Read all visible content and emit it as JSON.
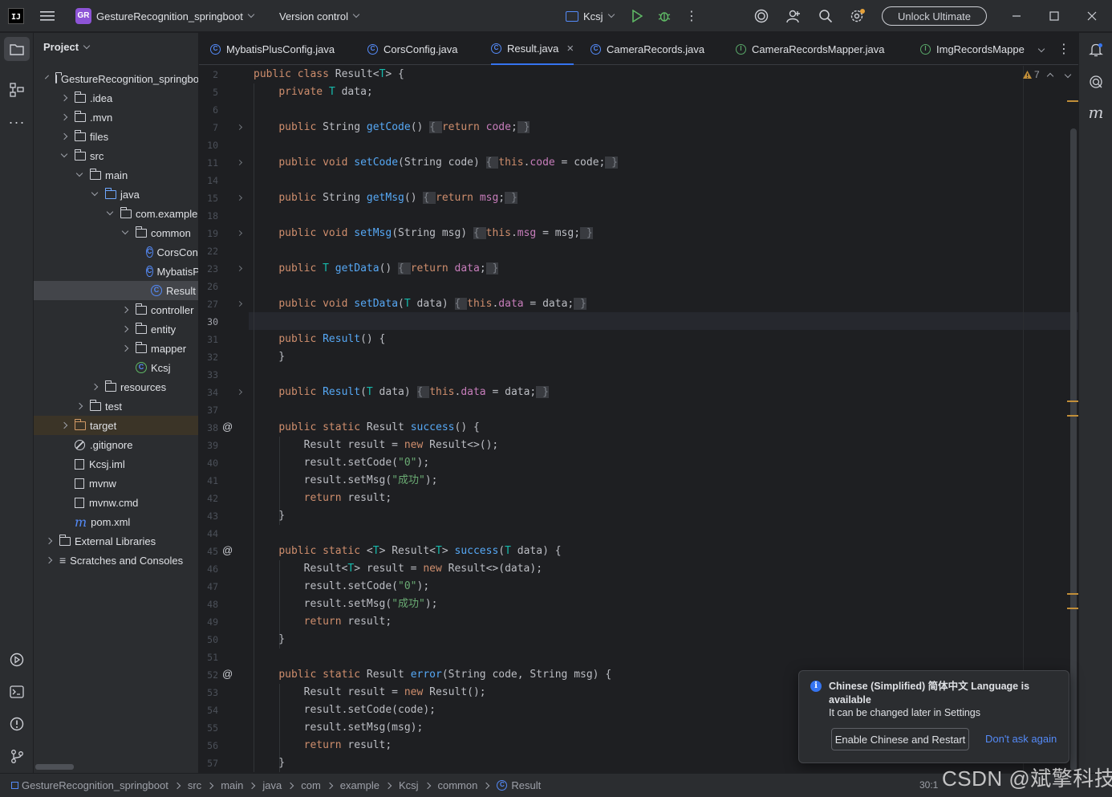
{
  "titlebar": {
    "app_badge": "GR",
    "project_name": "GestureRecognition_springboot",
    "version_control": "Version control",
    "run_config": "Kcsj",
    "unlock": "Unlock Ultimate"
  },
  "project_panel": {
    "title": "Project",
    "tree": [
      {
        "label": "GestureRecognition_springboot",
        "icon": "folder",
        "state": "expanded"
      },
      {
        "label": ".idea",
        "icon": "folder",
        "state": "collapsed"
      },
      {
        "label": ".mvn",
        "icon": "folder",
        "state": "collapsed"
      },
      {
        "label": "files",
        "icon": "folder",
        "state": "collapsed"
      },
      {
        "label": "src",
        "icon": "folder",
        "state": "expanded"
      },
      {
        "label": "main",
        "icon": "folder",
        "state": "expanded"
      },
      {
        "label": "java",
        "icon": "source-folder",
        "state": "expanded"
      },
      {
        "label": "com.example",
        "icon": "package",
        "state": "expanded"
      },
      {
        "label": "common",
        "icon": "package",
        "state": "expanded"
      },
      {
        "label": "CorsConfig",
        "icon": "class",
        "state": "leaf"
      },
      {
        "label": "MybatisPlusConfig",
        "icon": "class",
        "state": "leaf"
      },
      {
        "label": "Result",
        "icon": "class",
        "state": "leaf",
        "selected": true
      },
      {
        "label": "controller",
        "icon": "package",
        "state": "collapsed"
      },
      {
        "label": "entity",
        "icon": "package",
        "state": "collapsed"
      },
      {
        "label": "mapper",
        "icon": "package",
        "state": "collapsed"
      },
      {
        "label": "Kcsj",
        "icon": "spring-class",
        "state": "leaf"
      },
      {
        "label": "resources",
        "icon": "resources-folder",
        "state": "collapsed"
      },
      {
        "label": "test",
        "icon": "folder",
        "state": "collapsed"
      },
      {
        "label": "target",
        "icon": "target-folder",
        "state": "collapsed"
      },
      {
        "label": ".gitignore",
        "icon": "ignore-file",
        "state": "leaf"
      },
      {
        "label": "Kcsj.iml",
        "icon": "iml-file",
        "state": "leaf"
      },
      {
        "label": "mvnw",
        "icon": "script-file",
        "state": "leaf"
      },
      {
        "label": "mvnw.cmd",
        "icon": "text-file",
        "state": "leaf"
      },
      {
        "label": "pom.xml",
        "icon": "maven-file",
        "state": "leaf"
      },
      {
        "label": "External Libraries",
        "icon": "libraries",
        "state": "collapsed"
      },
      {
        "label": "Scratches and Consoles",
        "icon": "scratches",
        "state": "collapsed"
      }
    ]
  },
  "tabs": [
    {
      "label": "MybatisPlusConfig.java",
      "icon": "class",
      "active": false
    },
    {
      "label": "CorsConfig.java",
      "icon": "class",
      "active": false
    },
    {
      "label": "Result.java",
      "icon": "class",
      "active": true
    },
    {
      "label": "CameraRecords.java",
      "icon": "class",
      "active": false
    },
    {
      "label": "CameraRecordsMapper.java",
      "icon": "interface",
      "active": false
    },
    {
      "label": "ImgRecordsMappe",
      "icon": "interface",
      "active": false
    }
  ],
  "editor": {
    "warnings": "7",
    "current_line": "30",
    "lines": [
      {
        "n": "2",
        "code": "public class Result<T> {"
      },
      {
        "n": "5",
        "code": "    private T data;"
      },
      {
        "n": "6",
        "code": ""
      },
      {
        "n": "7",
        "code": "    public String getCode() { return code; }",
        "folded": true
      },
      {
        "n": "10",
        "code": ""
      },
      {
        "n": "11",
        "code": "    public void setCode(String code) { this.code = code; }",
        "folded": true
      },
      {
        "n": "14",
        "code": ""
      },
      {
        "n": "15",
        "code": "    public String getMsg() { return msg; }",
        "folded": true
      },
      {
        "n": "18",
        "code": ""
      },
      {
        "n": "19",
        "code": "    public void setMsg(String msg) { this.msg = msg; }",
        "folded": true
      },
      {
        "n": "22",
        "code": ""
      },
      {
        "n": "23",
        "code": "    public T getData() { return data; }",
        "folded": true
      },
      {
        "n": "26",
        "code": ""
      },
      {
        "n": "27",
        "code": "    public void setData(T data) { this.data = data; }",
        "folded": true
      },
      {
        "n": "30",
        "code": ""
      },
      {
        "n": "31",
        "code": "    public Result() {"
      },
      {
        "n": "32",
        "code": "    }"
      },
      {
        "n": "33",
        "code": ""
      },
      {
        "n": "34",
        "code": "    public Result(T data) { this.data = data; }",
        "folded": true
      },
      {
        "n": "37",
        "code": ""
      },
      {
        "n": "38",
        "code": "    public static Result success() {",
        "at": true
      },
      {
        "n": "39",
        "code": "        Result result = new Result<>();"
      },
      {
        "n": "40",
        "code": "        result.setCode(\"0\");"
      },
      {
        "n": "41",
        "code": "        result.setMsg(\"成功\");"
      },
      {
        "n": "42",
        "code": "        return result;"
      },
      {
        "n": "43",
        "code": "    }"
      },
      {
        "n": "44",
        "code": ""
      },
      {
        "n": "45",
        "code": "    public static <T> Result<T> success(T data) {",
        "at": true
      },
      {
        "n": "46",
        "code": "        Result<T> result = new Result<>(data);"
      },
      {
        "n": "47",
        "code": "        result.setCode(\"0\");"
      },
      {
        "n": "48",
        "code": "        result.setMsg(\"成功\");"
      },
      {
        "n": "49",
        "code": "        return result;"
      },
      {
        "n": "50",
        "code": "    }"
      },
      {
        "n": "51",
        "code": ""
      },
      {
        "n": "52",
        "code": "    public static Result error(String code, String msg) {",
        "at": true
      },
      {
        "n": "53",
        "code": "        Result result = new Result();"
      },
      {
        "n": "54",
        "code": "        result.setCode(code);"
      },
      {
        "n": "55",
        "code": "        result.setMsg(msg);"
      },
      {
        "n": "56",
        "code": "        return result;"
      },
      {
        "n": "57",
        "code": "    }"
      }
    ]
  },
  "notification": {
    "title": "Chinese (Simplified) 简体中文 Language is available",
    "body": "It can be changed later in Settings",
    "primary": "Enable Chinese and Restart",
    "secondary": "Don't ask again"
  },
  "statusbar": {
    "breadcrumbs": [
      "GestureRecognition_springboot",
      "src",
      "main",
      "java",
      "com",
      "example",
      "Kcsj",
      "common",
      "Result"
    ],
    "position": "30:1"
  },
  "watermark": "CSDN @斌擎科技",
  "colors": {
    "accent": "#3574f0",
    "keyword": "#cf8e6d",
    "function": "#56a8f5",
    "string": "#6aab73",
    "field": "#c77dbb",
    "type_param": "#16baac",
    "warning": "#c18e39"
  }
}
